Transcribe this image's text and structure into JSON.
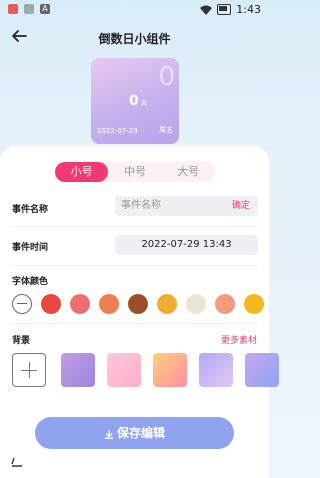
{
  "status_bar": {
    "time": "1:43"
  },
  "header": {
    "title": "倒数日小组件"
  },
  "preview": {
    "big_number": "0",
    "count": "0",
    "unit": "天",
    "date": "2022-07-29",
    "weekday": "周五"
  },
  "size_tabs": [
    {
      "label": "小号",
      "active": true
    },
    {
      "label": "中号",
      "active": false
    },
    {
      "label": "大号",
      "active": false
    }
  ],
  "event_name": {
    "label": "事件名称",
    "placeholder": "事件名称",
    "confirm": "确定"
  },
  "event_time": {
    "label": "事件时间",
    "value": "2022-07-29 13:43"
  },
  "font_color": {
    "label": "字体颜色",
    "swatches": [
      "none",
      "#e8473f",
      "#ee6f6f",
      "#ef7f52",
      "#9a4f2b",
      "#f2ab35",
      "#ece5d6",
      "#f39a7c",
      "#f4b91c"
    ]
  },
  "background": {
    "label": "背景",
    "more": "更多素材",
    "tiles": [
      "linear-gradient(135deg,#c39be2,#9a87e0)",
      "linear-gradient(135deg,#ffc6dc,#ffb0c7)",
      "linear-gradient(135deg,#ffd07a,#ff8fa4)",
      "linear-gradient(135deg,#b3a8f2,#e0c8f5)",
      "linear-gradient(135deg,#c6a5f0,#8ea6f0)"
    ]
  },
  "save_button": {
    "label": "保存编辑"
  },
  "colors": {
    "accent": "#f03a73",
    "button": "#8fa3ef"
  }
}
